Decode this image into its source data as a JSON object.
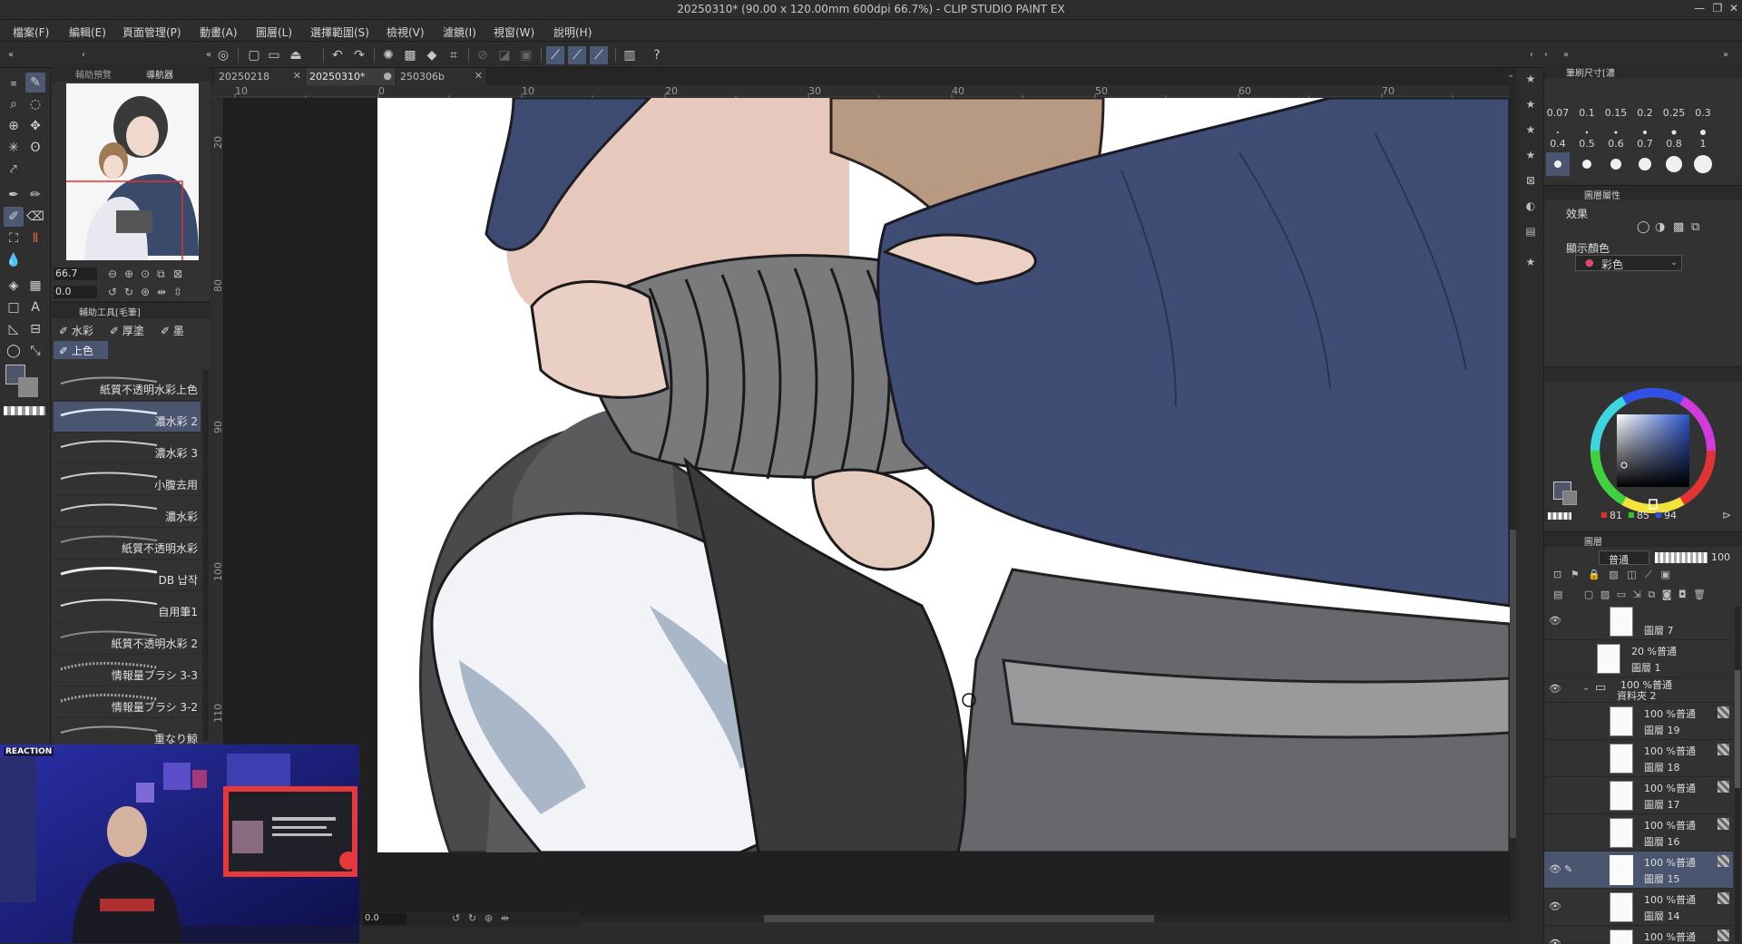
{
  "window": {
    "title": "20250310* (90.00 x 120.00mm 600dpi 66.7%) - CLIP STUDIO PAINT EX",
    "minimize": "—",
    "maximize": "❐",
    "close": "✕"
  },
  "menu": [
    "檔案(F)",
    "編輯(E)",
    "頁面管理(P)",
    "動畫(A)",
    "圖層(L)",
    "選擇範圍(S)",
    "檢視(V)",
    "濾鏡(I)",
    "視窗(W)",
    "說明(H)"
  ],
  "navigator": {
    "tabs": [
      "輔助預覽",
      "導航器"
    ],
    "zoom": "66.7",
    "rotation": "0.0"
  },
  "subtool": {
    "header": "輔助工具[毛筆]",
    "groups": [
      "水彩",
      "厚塗",
      "墨"
    ],
    "active_group": "上色",
    "brushes": [
      "紙質不透明水彩上色",
      "濃水彩 2",
      "濃水彩 3",
      "小腹去用",
      "濃水彩",
      "紙質不透明水彩",
      "DB 납작",
      "自用筆1",
      "紙質不透明水彩 2",
      "情報量ブラシ 3-3",
      "情報量ブラシ 3-2",
      "重なり鯨"
    ]
  },
  "document_tabs": [
    {
      "label": "20250218",
      "active": false
    },
    {
      "label": "20250310*",
      "active": true
    },
    {
      "label": "250306b",
      "active": false
    }
  ],
  "rulers": {
    "horizontal": [
      "10",
      "0",
      "10",
      "20",
      "30",
      "40",
      "50",
      "60",
      "70"
    ],
    "vertical": [
      "20",
      "80",
      "90",
      "100",
      "110"
    ]
  },
  "status": {
    "rotation": "0.0"
  },
  "brush_size": {
    "header": "筆刷尺寸[濃",
    "sizes_row1": [
      "0.07",
      "0.1",
      "0.15",
      "0.2",
      "0.25",
      "0.3"
    ],
    "sizes_row2": [
      "0.4",
      "0.5",
      "0.6",
      "0.7",
      "0.8",
      "1"
    ]
  },
  "layer_property": {
    "header": "圖層屬性",
    "effect_label": "效果",
    "display_color_label": "顯示顏色",
    "display_color_value": "彩色"
  },
  "color": {
    "r": "81",
    "g": "85",
    "b": "94",
    "main_color": "#515569"
  },
  "layers": {
    "header": "圖層",
    "blend_mode": "普通",
    "opacity": "100",
    "rows": [
      {
        "mode": "",
        "name": "圖層 7",
        "selected": false
      },
      {
        "mode": "20 %普通",
        "name": "圖層 1",
        "selected": false
      },
      {
        "mode": "100 %普通",
        "name": "資料夾 2",
        "selected": false,
        "folder": true
      },
      {
        "mode": "100 %普通",
        "name": "圖層 19",
        "selected": false
      },
      {
        "mode": "100 %普通",
        "name": "圖層 18",
        "selected": false
      },
      {
        "mode": "100 %普通",
        "name": "圖層 17",
        "selected": false
      },
      {
        "mode": "100 %普通",
        "name": "圖層 16",
        "selected": false
      },
      {
        "mode": "100 %普通",
        "name": "圖層 15",
        "selected": true
      },
      {
        "mode": "100 %普通",
        "name": "圖層 14",
        "selected": false
      },
      {
        "mode": "100 %普通",
        "name": "",
        "selected": false
      }
    ]
  },
  "webcam": {
    "badge": "REACTION"
  }
}
